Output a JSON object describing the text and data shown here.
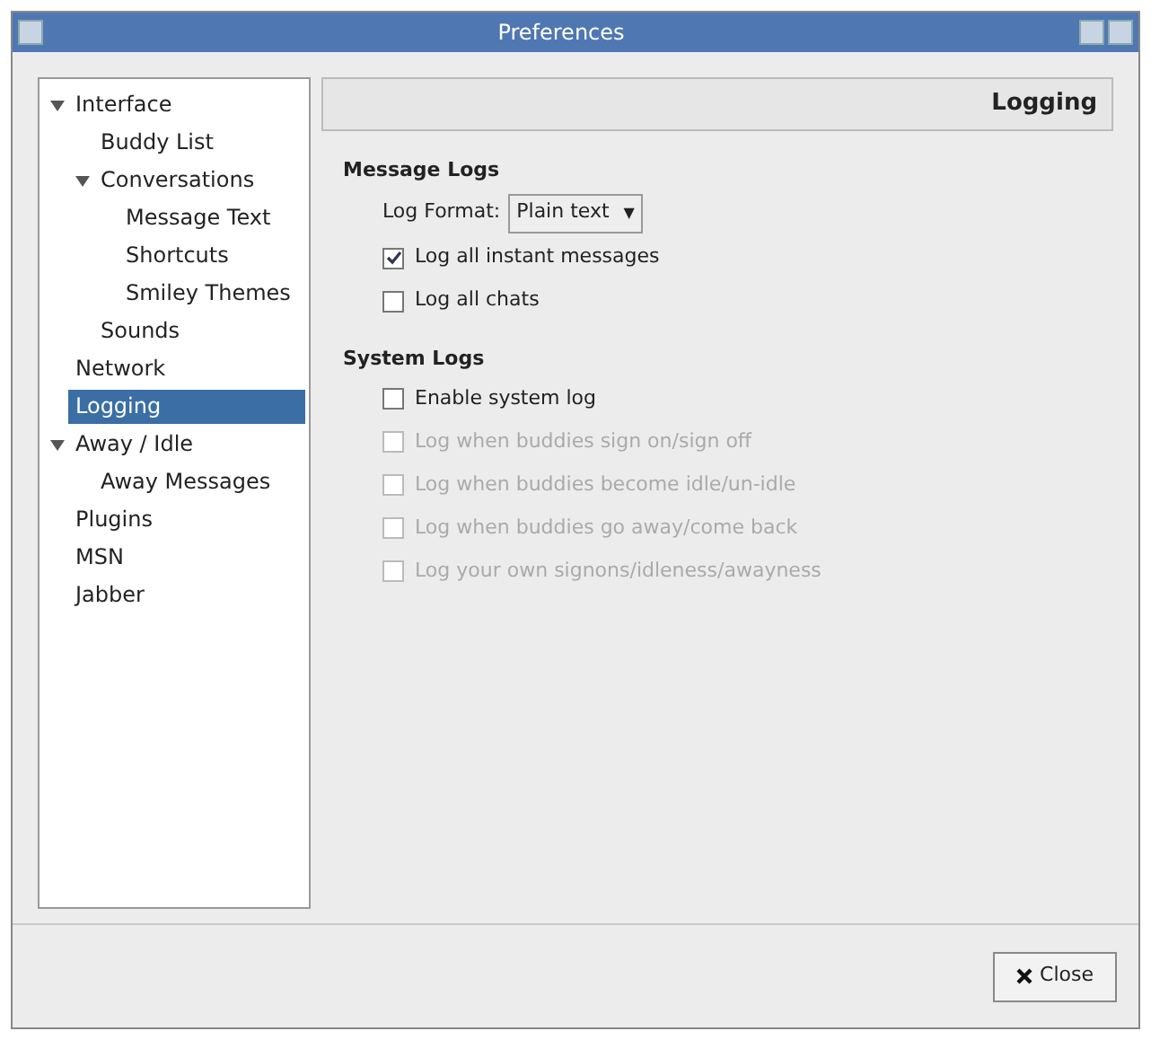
{
  "window": {
    "title": "Preferences"
  },
  "sidebar": {
    "items": [
      {
        "label": "Interface",
        "selected": false,
        "expanded": true,
        "children": [
          {
            "label": "Buddy List",
            "selected": false
          },
          {
            "label": "Conversations",
            "selected": false,
            "expanded": true,
            "children": [
              {
                "label": "Message Text",
                "selected": false
              },
              {
                "label": "Shortcuts",
                "selected": false
              },
              {
                "label": "Smiley Themes",
                "selected": false
              }
            ]
          },
          {
            "label": "Sounds",
            "selected": false
          }
        ]
      },
      {
        "label": "Network",
        "selected": false
      },
      {
        "label": "Logging",
        "selected": true
      },
      {
        "label": "Away / Idle",
        "selected": false,
        "expanded": true,
        "children": [
          {
            "label": "Away Messages",
            "selected": false
          }
        ]
      },
      {
        "label": "Plugins",
        "selected": false
      },
      {
        "label": "MSN",
        "selected": false
      },
      {
        "label": "Jabber",
        "selected": false
      }
    ]
  },
  "page": {
    "title": "Logging",
    "sections": [
      {
        "title": "Message Logs",
        "format": {
          "label": "Log Format:",
          "value": "Plain text",
          "arrow": "▼"
        },
        "options": [
          {
            "label": "Log all instant messages",
            "checked": true,
            "disabled": false
          },
          {
            "label": "Log all chats",
            "checked": false,
            "disabled": false
          }
        ]
      },
      {
        "title": "System Logs",
        "options": [
          {
            "label": "Enable system log",
            "checked": false,
            "disabled": false
          },
          {
            "label": "Log when buddies sign on/sign off",
            "checked": false,
            "disabled": true
          },
          {
            "label": "Log when buddies become idle/un-idle",
            "checked": false,
            "disabled": true
          },
          {
            "label": "Log when buddies go away/come back",
            "checked": false,
            "disabled": true
          },
          {
            "label": "Log your own signons/idleness/awayness",
            "checked": false,
            "disabled": true
          }
        ]
      }
    ]
  },
  "buttons": [
    {
      "label": "Close"
    }
  ]
}
